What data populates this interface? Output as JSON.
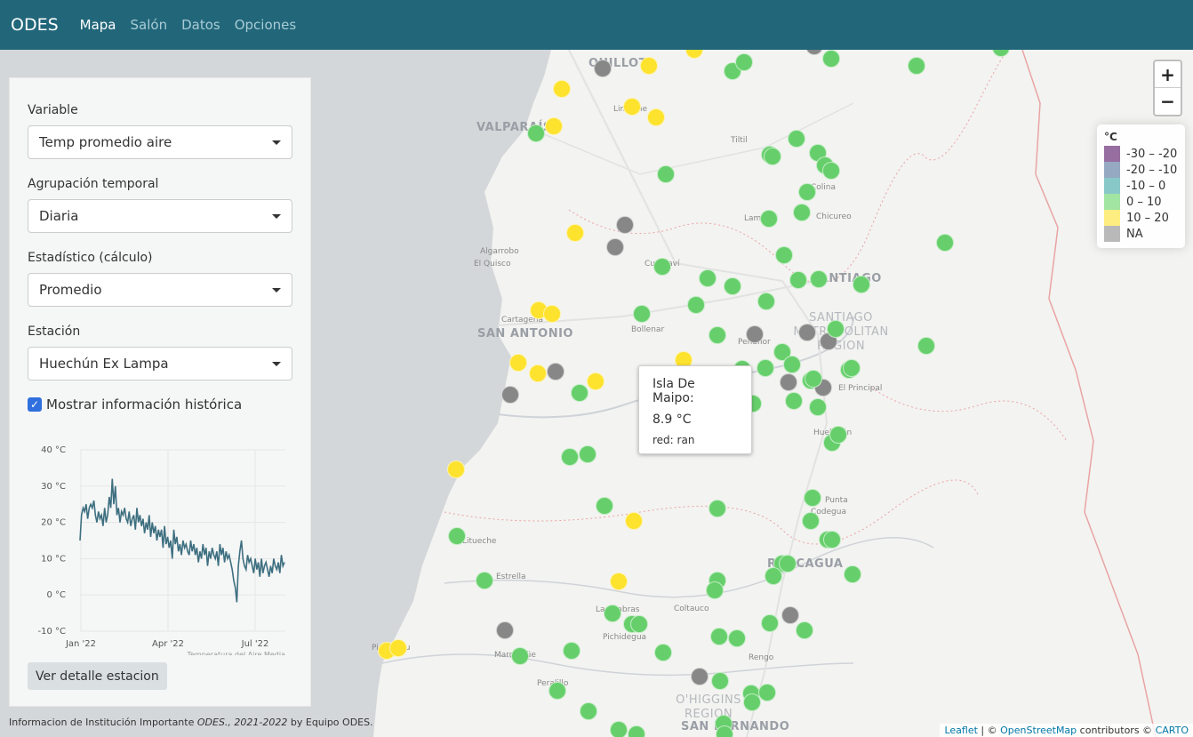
{
  "nav": {
    "brand": "ODES",
    "items": [
      {
        "label": "Mapa",
        "active": true
      },
      {
        "label": "Salón",
        "active": false
      },
      {
        "label": "Datos",
        "active": false
      },
      {
        "label": "Opciones",
        "active": false
      }
    ]
  },
  "panel": {
    "variable_label": "Variable",
    "variable_value": "Temp promedio aire",
    "agrupacion_label": "Agrupación temporal",
    "agrupacion_value": "Diaria",
    "estadistico_label": "Estadístico (cálculo)",
    "estadistico_value": "Promedio",
    "estacion_label": "Estación",
    "estacion_value": "Huechún Ex Lampa",
    "historico_label": "Mostrar información histórica",
    "historico_checked": true,
    "button_label": "Ver detalle estacion"
  },
  "chart_data": {
    "type": "line",
    "caption": "Temperatura del Aire Media",
    "yticks": [
      "40 °C",
      "30 °C",
      "20 °C",
      "10 °C",
      "0 °C",
      "-10 °C"
    ],
    "ylim": [
      -10,
      40
    ],
    "xticks": [
      "Jan '22",
      "Apr '22",
      "Jul '22"
    ],
    "color": "#3d6f80",
    "series": [
      {
        "values": [
          15,
          22,
          24,
          23,
          25,
          21,
          24,
          25,
          24,
          26,
          22,
          20,
          23,
          21,
          22,
          19,
          24,
          20,
          22,
          27,
          24,
          32,
          25,
          30,
          22,
          24,
          20,
          23,
          22,
          24,
          21,
          20,
          23,
          19,
          21,
          22,
          18,
          24,
          20,
          22,
          19,
          21,
          17,
          20,
          18,
          22,
          16,
          20,
          17,
          19,
          15,
          18,
          16,
          18,
          13,
          19,
          14,
          16,
          13,
          15,
          10,
          18,
          14,
          16,
          12,
          14,
          11,
          15,
          13,
          14,
          12,
          11,
          15,
          12,
          14,
          11,
          13,
          9,
          12,
          10,
          14,
          11,
          13,
          8,
          12,
          10,
          13,
          11,
          10,
          12,
          8,
          14,
          11,
          13,
          9,
          12,
          10,
          11,
          9,
          7,
          4,
          2,
          -2,
          8,
          12,
          15,
          10,
          8,
          7,
          11,
          9,
          10,
          8,
          6,
          10,
          7,
          9,
          5,
          10,
          6,
          8,
          9,
          7,
          5,
          8,
          6,
          10,
          8,
          7,
          9,
          6,
          11,
          8,
          9
        ]
      }
    ]
  },
  "map": {
    "places": [
      {
        "name": "QUILLOTA",
        "big": true
      },
      {
        "name": "VALPARAÍSO",
        "big": true
      },
      {
        "name": "Limache"
      },
      {
        "name": "Tiltil"
      },
      {
        "name": "Colina"
      },
      {
        "name": "Lampa"
      },
      {
        "name": "Chicureo"
      },
      {
        "name": "Algarrobo"
      },
      {
        "name": "El Quisco"
      },
      {
        "name": "Curacaví"
      },
      {
        "name": "SANTIAGO",
        "big": true
      },
      {
        "name": "Cartagena"
      },
      {
        "name": "SAN ANTONIO",
        "big": true
      },
      {
        "name": "Bollenar"
      },
      {
        "name": "Peñaflor"
      },
      {
        "name": "El Principal"
      },
      {
        "name": "Huelquén"
      },
      {
        "name": "Punta"
      },
      {
        "name": "Codegua"
      },
      {
        "name": "RANCAGUA",
        "big": true
      },
      {
        "name": "Litueche"
      },
      {
        "name": "Estrella"
      },
      {
        "name": "Coltauco"
      },
      {
        "name": "Las Cabras"
      },
      {
        "name": "Pichidegua"
      },
      {
        "name": "Rengo"
      },
      {
        "name": "Pichilemu"
      },
      {
        "name": "Marchigüe"
      },
      {
        "name": "Peralillo"
      },
      {
        "name": "SAN FERNANDO",
        "big": true
      }
    ],
    "regions": [
      "SANTIAGO\nMETROPOLITAN\nREGION",
      "O'HIGGINS\nREGION"
    ],
    "zoom_in": "+",
    "zoom_out": "−"
  },
  "legend": {
    "title": "°C",
    "items": [
      {
        "label": "-30 – -20",
        "color": "#6b3078"
      },
      {
        "label": "-20 – -10",
        "color": "#6a85a8"
      },
      {
        "label": "-10 – 0",
        "color": "#55b0b0"
      },
      {
        "label": "0 – 10",
        "color": "#7bd97b"
      },
      {
        "label": "10 – 20",
        "color": "#fde74c"
      },
      {
        "label": "NA",
        "color": "#9b9b9b"
      }
    ]
  },
  "tooltip": {
    "name": "Isla De Maipo:",
    "value": "8.9 °C",
    "network": "red: ran"
  },
  "colors": {
    "green": "#66cf6b",
    "yellow": "#fde22e",
    "gray": "#878787",
    "navbar": "#22667a"
  },
  "footer": {
    "prefix": "Informacion de Institución Importante",
    "italic": "ODES., 2021-2022",
    "suffix": "by Equipo ODES."
  },
  "attribution": {
    "leaflet": "Leaflet",
    "sep": " | © ",
    "osm": "OpenStreetMap",
    "contrib": " contributors © ",
    "carto": "CARTO"
  }
}
